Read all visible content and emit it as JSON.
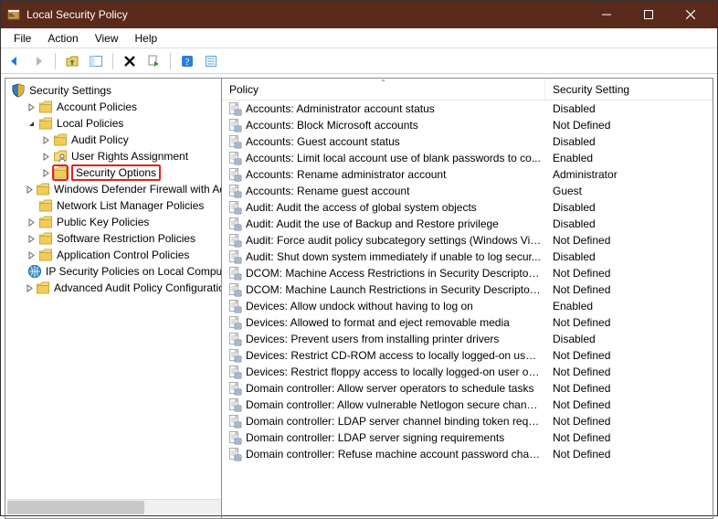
{
  "window": {
    "title": "Local Security Policy"
  },
  "menubar": [
    "File",
    "Action",
    "View",
    "Help"
  ],
  "tree": {
    "root": "Security Settings",
    "nodes": [
      {
        "label": "Account Policies",
        "depth": 1,
        "expander": ">",
        "icon": "folder"
      },
      {
        "label": "Local Policies",
        "depth": 1,
        "expander": "v",
        "icon": "folder"
      },
      {
        "label": "Audit Policy",
        "depth": 2,
        "expander": ">",
        "icon": "folder"
      },
      {
        "label": "User Rights Assignment",
        "depth": 2,
        "expander": ">",
        "icon": "folder-user"
      },
      {
        "label": "Security Options",
        "depth": 2,
        "expander": ">",
        "icon": "folder",
        "highlight": true
      },
      {
        "label": "Windows Defender Firewall with Advanced Security",
        "depth": 1,
        "expander": ">",
        "icon": "folder"
      },
      {
        "label": "Network List Manager Policies",
        "depth": 1,
        "expander": "",
        "icon": "folder"
      },
      {
        "label": "Public Key Policies",
        "depth": 1,
        "expander": ">",
        "icon": "folder"
      },
      {
        "label": "Software Restriction Policies",
        "depth": 1,
        "expander": ">",
        "icon": "folder"
      },
      {
        "label": "Application Control Policies",
        "depth": 1,
        "expander": ">",
        "icon": "folder"
      },
      {
        "label": "IP Security Policies on Local Computer",
        "depth": 1,
        "expander": "",
        "icon": "globe"
      },
      {
        "label": "Advanced Audit Policy Configuration",
        "depth": 1,
        "expander": ">",
        "icon": "folder"
      }
    ]
  },
  "list": {
    "columns": {
      "policy": "Policy",
      "setting": "Security Setting"
    },
    "rows": [
      {
        "policy": "Accounts: Administrator account status",
        "setting": "Disabled"
      },
      {
        "policy": "Accounts: Block Microsoft accounts",
        "setting": "Not Defined"
      },
      {
        "policy": "Accounts: Guest account status",
        "setting": "Disabled"
      },
      {
        "policy": "Accounts: Limit local account use of blank passwords to co...",
        "setting": "Enabled"
      },
      {
        "policy": "Accounts: Rename administrator account",
        "setting": "Administrator"
      },
      {
        "policy": "Accounts: Rename guest account",
        "setting": "Guest"
      },
      {
        "policy": "Audit: Audit the access of global system objects",
        "setting": "Disabled"
      },
      {
        "policy": "Audit: Audit the use of Backup and Restore privilege",
        "setting": "Disabled"
      },
      {
        "policy": "Audit: Force audit policy subcategory settings (Windows Vis...",
        "setting": "Not Defined"
      },
      {
        "policy": "Audit: Shut down system immediately if unable to log secur...",
        "setting": "Disabled"
      },
      {
        "policy": "DCOM: Machine Access Restrictions in Security Descriptor D...",
        "setting": "Not Defined"
      },
      {
        "policy": "DCOM: Machine Launch Restrictions in Security Descriptor ...",
        "setting": "Not Defined"
      },
      {
        "policy": "Devices: Allow undock without having to log on",
        "setting": "Enabled"
      },
      {
        "policy": "Devices: Allowed to format and eject removable media",
        "setting": "Not Defined"
      },
      {
        "policy": "Devices: Prevent users from installing printer drivers",
        "setting": "Disabled"
      },
      {
        "policy": "Devices: Restrict CD-ROM access to locally logged-on user ...",
        "setting": "Not Defined"
      },
      {
        "policy": "Devices: Restrict floppy access to locally logged-on user only",
        "setting": "Not Defined"
      },
      {
        "policy": "Domain controller: Allow server operators to schedule tasks",
        "setting": "Not Defined"
      },
      {
        "policy": "Domain controller: Allow vulnerable Netlogon secure chann...",
        "setting": "Not Defined"
      },
      {
        "policy": "Domain controller: LDAP server channel binding token requi...",
        "setting": "Not Defined"
      },
      {
        "policy": "Domain controller: LDAP server signing requirements",
        "setting": "Not Defined"
      },
      {
        "policy": "Domain controller: Refuse machine account password chan...",
        "setting": "Not Defined"
      }
    ]
  }
}
